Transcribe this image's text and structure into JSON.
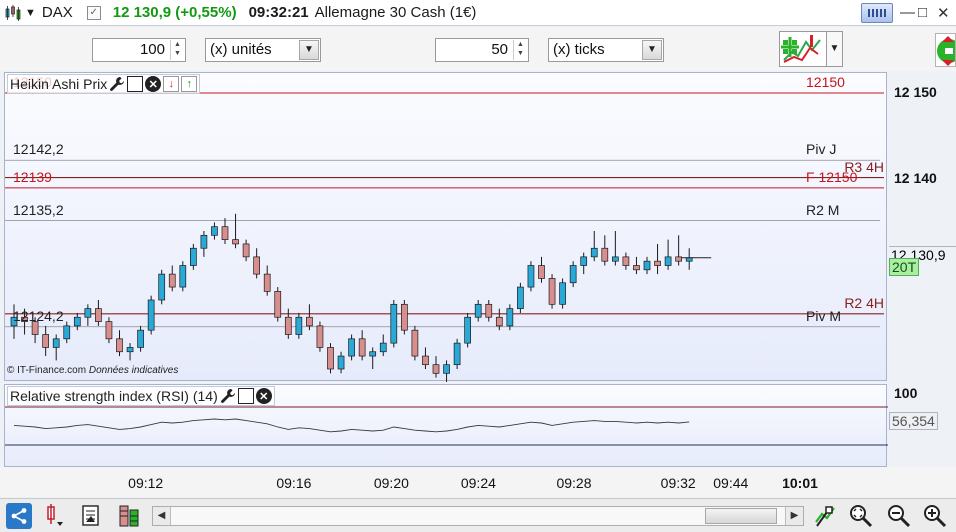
{
  "titlebar": {
    "symbol": "DAX",
    "price_change": "12 130,9 (+0,55%)",
    "time": "09:32:21",
    "instrument": "Allemagne 30 Cash (1€)",
    "min_glyph": "—",
    "max_glyph": "□",
    "close_glyph": "✕"
  },
  "toolbar": {
    "quantity_value": "100",
    "quantity_unit": "(x) unités",
    "ticks_value": "50",
    "ticks_unit": "(x) ticks"
  },
  "price_panel": {
    "indicator_title": "Heikin Ashi Prix",
    "source_credit": "© IT-Finance.com",
    "source_note": "Données indicatives",
    "levels": [
      {
        "left_label": "12150",
        "right_label": "12150",
        "price": 12150,
        "color": "#c8141e",
        "style": "solid"
      },
      {
        "left_label": "12142,2",
        "right_label": "Piv J",
        "price": 12142.2,
        "color": "#8a8a96",
        "style": "thin"
      },
      {
        "left_label": "",
        "right_label": "R3 4H",
        "price": 12140.2,
        "color": "#8a2020",
        "style": "solid"
      },
      {
        "left_label": "12139",
        "right_label": "F 12150",
        "price": 12139,
        "color": "#c8141e",
        "style": "solid"
      },
      {
        "left_label": "12135,2",
        "right_label": "R2 M",
        "price": 12135.2,
        "color": "#8a8a96",
        "style": "thin"
      },
      {
        "left_label": "",
        "right_label": "R2 4H",
        "price": 12124.4,
        "color": "#8a2020",
        "style": "solid"
      },
      {
        "left_label": "12124,2",
        "right_label": "Piv M",
        "price": 12122.9,
        "color": "#8a8a96",
        "style": "thin"
      }
    ],
    "axis_labels": [
      {
        "text": "12 150",
        "price": 12150
      },
      {
        "text": "12 140",
        "price": 12140
      }
    ],
    "current_price_label": "12 130,9",
    "current_price": 12130.9,
    "timer_badge": "20T"
  },
  "rsi_panel": {
    "title": "Relative strength index (RSI) (14)",
    "axis_label": "100",
    "value_label": "56,354"
  },
  "time_axis": {
    "ticks": [
      {
        "text": "09:12",
        "x": 0.155,
        "bold": false
      },
      {
        "text": "09:16",
        "x": 0.31,
        "bold": false
      },
      {
        "text": "09:20",
        "x": 0.412,
        "bold": false
      },
      {
        "text": "09:24",
        "x": 0.503,
        "bold": false
      },
      {
        "text": "09:28",
        "x": 0.603,
        "bold": false
      },
      {
        "text": "09:32",
        "x": 0.712,
        "bold": false
      },
      {
        "text": "09:44",
        "x": 0.767,
        "bold": false
      },
      {
        "text": "10:01",
        "x": 0.839,
        "bold": true
      }
    ]
  },
  "chart_data": {
    "type": "candlestick",
    "y_range": [
      12118,
      12150
    ],
    "candles_ohlc": [
      [
        12123.0,
        12125.5,
        12121.5,
        12124.0
      ],
      [
        12124.0,
        12125.0,
        12122.0,
        12123.5
      ],
      [
        12123.5,
        12124.0,
        12121.0,
        12122.0
      ],
      [
        12122.0,
        12123.0,
        12119.5,
        12120.5
      ],
      [
        12120.5,
        12122.0,
        12119.0,
        12121.5
      ],
      [
        12121.5,
        12123.5,
        12121.0,
        12123.0
      ],
      [
        12123.0,
        12124.5,
        12122.5,
        12124.0
      ],
      [
        12124.0,
        12125.5,
        12123.0,
        12125.0
      ],
      [
        12125.0,
        12126.0,
        12123.0,
        12123.5
      ],
      [
        12123.5,
        12124.0,
        12121.0,
        12121.5
      ],
      [
        12121.5,
        12122.5,
        12119.5,
        12120.0
      ],
      [
        12120.0,
        12121.0,
        12119.0,
        12120.5
      ],
      [
        12120.5,
        12123.0,
        12120.0,
        12122.5
      ],
      [
        12122.5,
        12126.5,
        12122.0,
        12126.0
      ],
      [
        12126.0,
        12129.5,
        12125.5,
        12129.0
      ],
      [
        12129.0,
        12130.0,
        12127.0,
        12127.5
      ],
      [
        12127.5,
        12130.5,
        12127.0,
        12130.0
      ],
      [
        12130.0,
        12132.5,
        12129.5,
        12132.0
      ],
      [
        12132.0,
        12134.0,
        12131.0,
        12133.5
      ],
      [
        12133.5,
        12135.0,
        12133.0,
        12134.5
      ],
      [
        12134.5,
        12135.5,
        12132.5,
        12133.0
      ],
      [
        12133.0,
        12136.0,
        12132.0,
        12132.5
      ],
      [
        12132.5,
        12133.0,
        12130.5,
        12131.0
      ],
      [
        12131.0,
        12132.0,
        12128.5,
        12129.0
      ],
      [
        12129.0,
        12130.0,
        12126.5,
        12127.0
      ],
      [
        12127.0,
        12127.5,
        12123.5,
        12124.0
      ],
      [
        12124.0,
        12125.0,
        12121.5,
        12122.0
      ],
      [
        12122.0,
        12124.5,
        12121.5,
        12124.0
      ],
      [
        12124.0,
        12125.5,
        12122.5,
        12123.0
      ],
      [
        12123.0,
        12123.5,
        12120.0,
        12120.5
      ],
      [
        12120.5,
        12121.0,
        12117.5,
        12118.0
      ],
      [
        12118.0,
        12120.0,
        12117.5,
        12119.5
      ],
      [
        12119.5,
        12122.0,
        12119.0,
        12121.5
      ],
      [
        12121.5,
        12122.5,
        12119.0,
        12119.5
      ],
      [
        12119.5,
        12120.5,
        12118.0,
        12120.0
      ],
      [
        12120.0,
        12122.0,
        12119.5,
        12121.0
      ],
      [
        12121.0,
        12126.0,
        12120.5,
        12125.5
      ],
      [
        12125.5,
        12126.0,
        12122.0,
        12122.5
      ],
      [
        12122.5,
        12123.0,
        12119.0,
        12119.5
      ],
      [
        12119.5,
        12120.5,
        12118.0,
        12118.5
      ],
      [
        12118.5,
        12119.5,
        12117.0,
        12117.5
      ],
      [
        12117.5,
        12119.0,
        12116.5,
        12118.5
      ],
      [
        12118.5,
        12121.5,
        12118.0,
        12121.0
      ],
      [
        12121.0,
        12124.5,
        12120.5,
        12124.0
      ],
      [
        12124.0,
        12126.0,
        12123.5,
        12125.5
      ],
      [
        12125.5,
        12126.0,
        12123.5,
        12124.0
      ],
      [
        12124.0,
        12125.0,
        12122.5,
        12123.0
      ],
      [
        12123.0,
        12125.5,
        12122.5,
        12125.0
      ],
      [
        12125.0,
        12128.0,
        12124.5,
        12127.5
      ],
      [
        12127.5,
        12130.5,
        12127.0,
        12130.0
      ],
      [
        12130.0,
        12131.0,
        12128.0,
        12128.5
      ],
      [
        12128.5,
        12129.0,
        12125.0,
        12125.5
      ],
      [
        12125.5,
        12128.5,
        12125.0,
        12128.0
      ],
      [
        12128.0,
        12130.5,
        12127.5,
        12130.0
      ],
      [
        12130.0,
        12131.5,
        12129.0,
        12131.0
      ],
      [
        12131.0,
        12134.0,
        12130.5,
        12132.0
      ],
      [
        12132.0,
        12133.5,
        12130.0,
        12130.5
      ],
      [
        12130.5,
        12134.0,
        12130.0,
        12131.0
      ],
      [
        12131.0,
        12131.5,
        12129.5,
        12130.0
      ],
      [
        12130.0,
        12131.0,
        12129.0,
        12129.5
      ],
      [
        12129.5,
        12131.0,
        12129.0,
        12130.5
      ],
      [
        12130.5,
        12132.5,
        12129.0,
        12130.0
      ],
      [
        12130.0,
        12133.0,
        12129.5,
        12131.0
      ],
      [
        12131.0,
        12133.5,
        12130.0,
        12130.5
      ],
      [
        12130.5,
        12132.0,
        12129.5,
        12130.9
      ]
    ],
    "rsi_values": [
      52,
      51,
      50,
      48,
      49,
      50,
      52,
      53,
      51,
      49,
      47,
      48,
      50,
      53,
      56,
      55,
      56,
      58,
      59,
      60,
      59,
      60,
      58,
      56,
      54,
      50,
      47,
      49,
      48,
      46,
      44,
      45,
      47,
      46,
      45,
      46,
      50,
      48,
      46,
      45,
      44,
      45,
      47,
      50,
      52,
      51,
      50,
      52,
      54,
      56,
      55,
      52,
      54,
      56,
      57,
      58,
      57,
      57,
      56,
      55,
      56,
      55,
      56,
      55,
      56.354
    ],
    "colors": {
      "up_fill": "#2aa9d6",
      "down_fill": "#d98e8e",
      "wick": "#1a1a1a",
      "rsi_line": "#3a3a3a",
      "rsi_upper": "#7b1f2b",
      "rsi_lower": "#23305a"
    }
  }
}
